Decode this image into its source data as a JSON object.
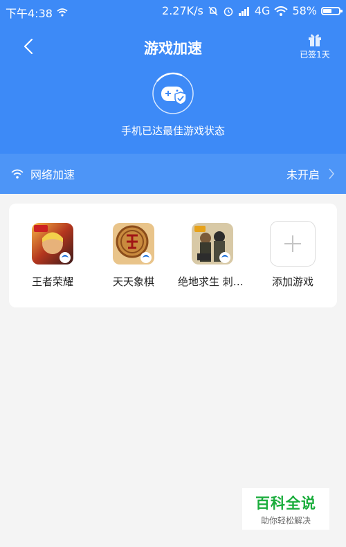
{
  "status_bar": {
    "time": "下午4:38",
    "speed": "2.27K/s",
    "network": "4G",
    "battery_percent": "58%",
    "battery_level": 0.58
  },
  "header": {
    "title": "游戏加速",
    "sign_label": "已签1天",
    "state_text": "手机已达最佳游戏状态"
  },
  "net_accel": {
    "label": "网络加速",
    "status": "未开启"
  },
  "games": [
    {
      "name": "王者荣耀"
    },
    {
      "name": "天天象棋"
    },
    {
      "name": "绝地求生 刺激战场"
    },
    {
      "name": "添加游戏"
    }
  ],
  "watermark": {
    "title": "百科全说",
    "subtitle": "助你轻松解决"
  },
  "colors": {
    "header_bg": "#3d8af7",
    "netbar_bg": "#4d95f7",
    "watermark_green": "#1aad3c"
  }
}
